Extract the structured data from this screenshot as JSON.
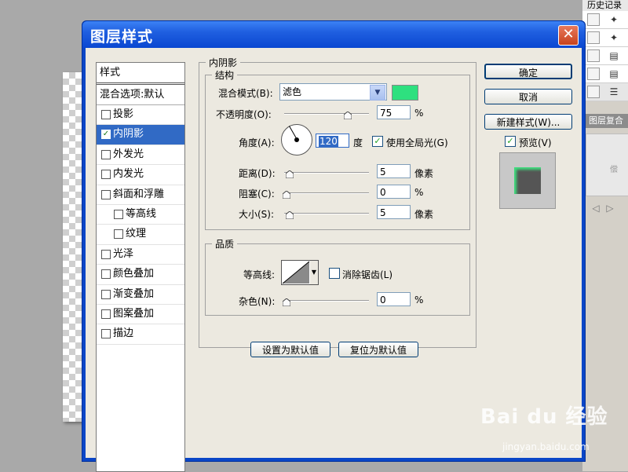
{
  "background": {
    "history_title": "历史记录",
    "layer_comp_title": "图层复合",
    "layer_comp_thumb": "偿"
  },
  "dialog": {
    "title": "图层样式",
    "close_icon": "✕"
  },
  "style_list": {
    "header": "样式",
    "blend_options": "混合选项:默认",
    "items": [
      {
        "label": "投影",
        "checked": false
      },
      {
        "label": "内阴影",
        "checked": true,
        "selected": true
      },
      {
        "label": "外发光",
        "checked": false
      },
      {
        "label": "内发光",
        "checked": false
      },
      {
        "label": "斜面和浮雕",
        "checked": false
      },
      {
        "label": "等高线",
        "checked": false,
        "indent": true
      },
      {
        "label": "纹理",
        "checked": false,
        "indent": true
      },
      {
        "label": "光泽",
        "checked": false
      },
      {
        "label": "颜色叠加",
        "checked": false
      },
      {
        "label": "渐变叠加",
        "checked": false
      },
      {
        "label": "图案叠加",
        "checked": false
      },
      {
        "label": "描边",
        "checked": false
      }
    ]
  },
  "inner_shadow": {
    "title": "内阴影",
    "structure": {
      "title": "结构",
      "blend_mode_label": "混合模式(B):",
      "blend_mode_value": "滤色",
      "shadow_color": "#2ee07f",
      "opacity_label": "不透明度(O):",
      "opacity_value": "75",
      "opacity_unit": "%",
      "opacity_fraction": 0.75,
      "angle_label": "角度(A):",
      "angle_value": "120",
      "angle_unit": "度",
      "global_light_label": "使用全局光(G)",
      "global_light_checked": true,
      "distance_label": "距离(D):",
      "distance_value": "5",
      "distance_unit": "像素",
      "choke_label": "阻塞(C):",
      "choke_value": "0",
      "choke_unit": "%",
      "size_label": "大小(S):",
      "size_value": "5",
      "size_unit": "像素"
    },
    "quality": {
      "title": "品质",
      "contour_label": "等高线:",
      "anti_alias_label": "消除锯齿(L)",
      "anti_alias_checked": false,
      "noise_label": "杂色(N):",
      "noise_value": "0",
      "noise_unit": "%"
    },
    "make_default": "设置为默认值",
    "reset_default": "复位为默认值"
  },
  "buttons": {
    "ok": "确定",
    "cancel": "取消",
    "new_style": "新建样式(W)...",
    "preview_label": "预览(V)",
    "preview_checked": true
  },
  "watermark": {
    "brand": "Bai du 经验",
    "url": "jingyan.baidu.com"
  }
}
